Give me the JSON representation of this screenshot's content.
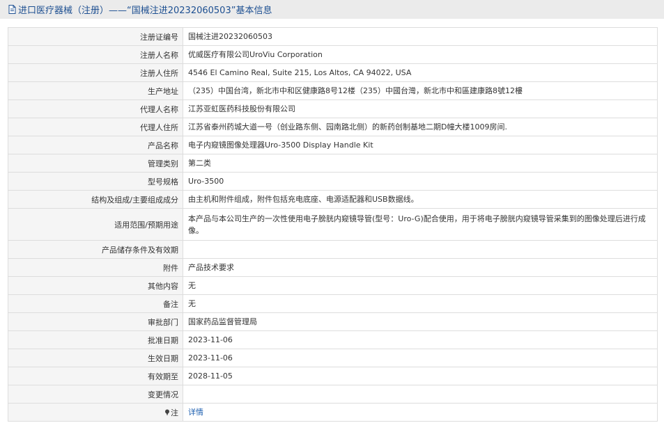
{
  "header": {
    "title": "进口医疗器械（注册）——“国械注进20232060503”基本信息",
    "icon": "document-icon"
  },
  "rows": [
    {
      "label": "注册证编号",
      "value": "国械注进20232060503"
    },
    {
      "label": "注册人名称",
      "value": "优威医疗有限公司UroViu Corporation"
    },
    {
      "label": "注册人住所",
      "value": "4546 El Camino Real, Suite 215, Los Altos, CA 94022, USA"
    },
    {
      "label": "生产地址",
      "value": "（235）中国台湾，新北市中和区健康路8号12楼（235）中國台灣，新北市中和區建康路8號12樓"
    },
    {
      "label": "代理人名称",
      "value": "江苏亚虹医药科技股份有限公司"
    },
    {
      "label": "代理人住所",
      "value": "江苏省泰州药城大道一号（创业路东侧、园南路北侧）的新药创制基地二期D幢大楼1009房间."
    },
    {
      "label": "产品名称",
      "value": "电子内窥镜图像处理器Uro-3500 Display Handle Kit"
    },
    {
      "label": "管理类别",
      "value": "第二类"
    },
    {
      "label": "型号规格",
      "value": "Uro-3500"
    },
    {
      "label": "结构及组成/主要组成成分",
      "value": "由主机和附件组成，附件包括充电底座、电源适配器和USB数据线。"
    },
    {
      "label": "适用范围/预期用途",
      "value": "本产品与本公司生产的一次性使用电子膀胱内窥镜导管(型号：Uro-G)配合使用，用于将电子膀胱内窥镜导管采集到的图像处理后进行成像。"
    },
    {
      "label": "产品储存条件及有效期",
      "value": ""
    },
    {
      "label": "附件",
      "value": "产品技术要求"
    },
    {
      "label": "其他内容",
      "value": "无"
    },
    {
      "label": "备注",
      "value": "无"
    },
    {
      "label": "审批部门",
      "value": "国家药品监督管理局"
    },
    {
      "label": "批准日期",
      "value": "2023-11-06"
    },
    {
      "label": "生效日期",
      "value": "2023-11-06"
    },
    {
      "label": "有效期至",
      "value": "2028-11-05"
    },
    {
      "label": "变更情况",
      "value": ""
    }
  ],
  "note_row": {
    "label": "注",
    "icon": "pin-icon",
    "link_text": "详情"
  },
  "colors": {
    "title_text": "#1d4f91",
    "title_bg": "#ebebeb",
    "label_bg": "#f5f5f5",
    "border": "#dddddd",
    "link": "#1d5fb0"
  }
}
